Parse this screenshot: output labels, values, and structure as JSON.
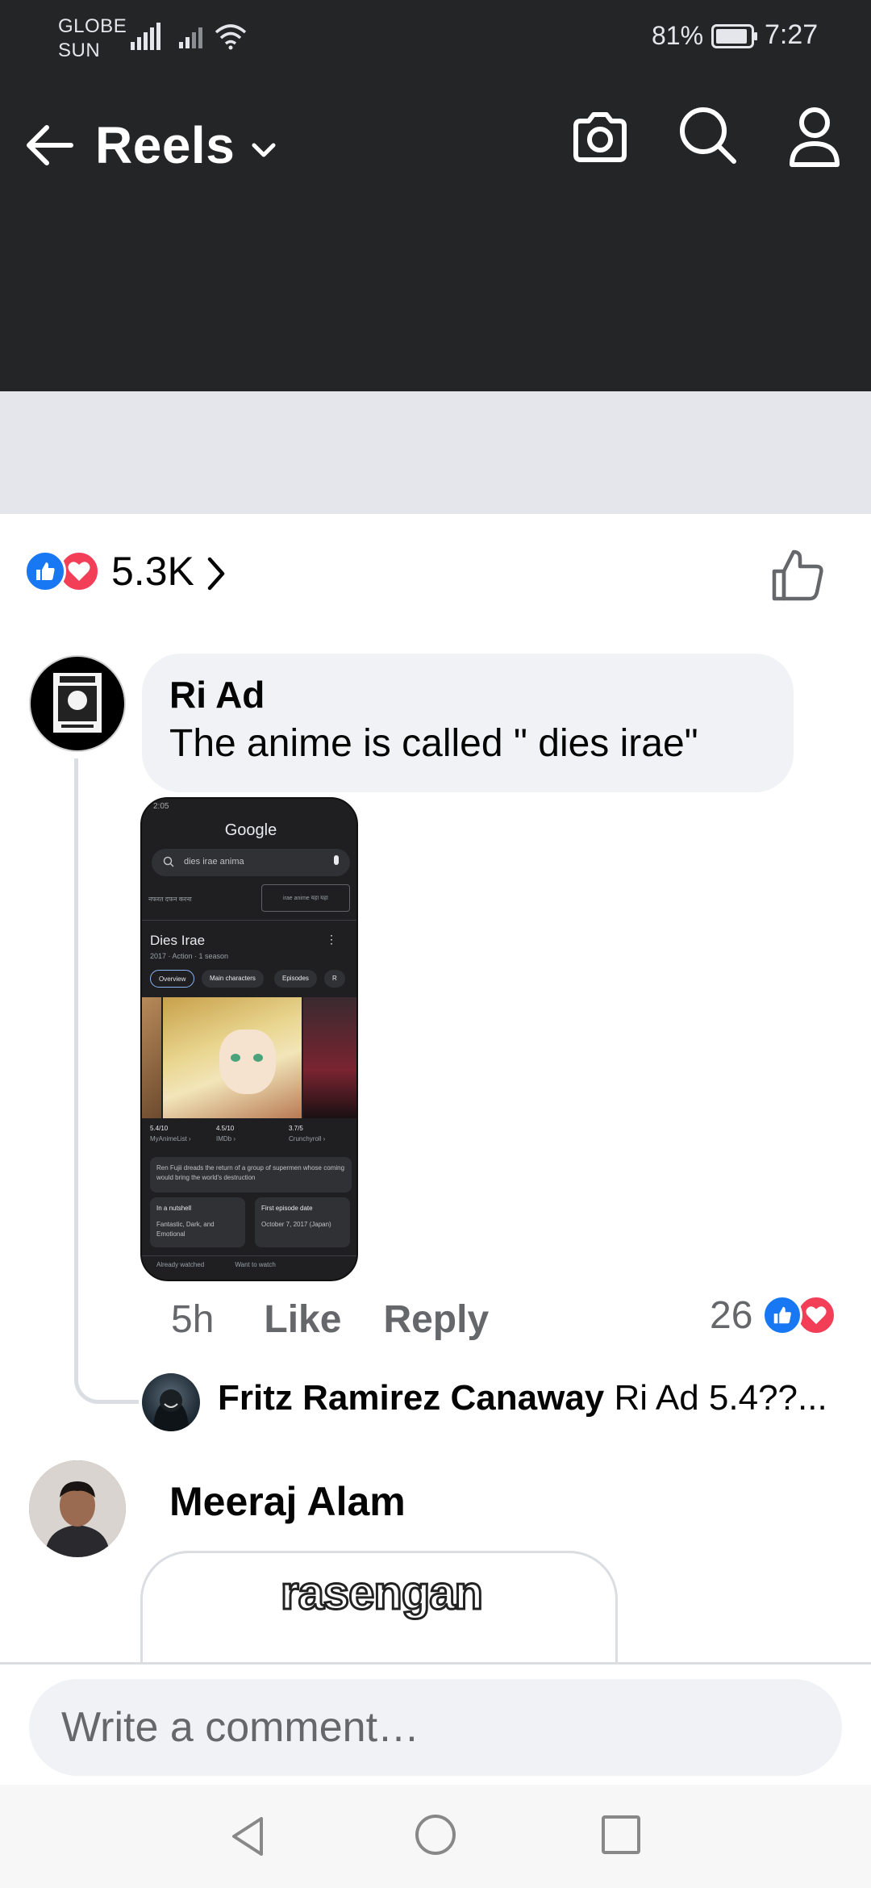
{
  "status_bar": {
    "carrier_line1": "GLOBE",
    "carrier_line2": "SUN",
    "battery": "81%",
    "time": "7:27"
  },
  "header": {
    "title": "Reels",
    "icons": [
      "back-arrow-icon",
      "chevron-down-icon",
      "camera-icon",
      "search-icon",
      "profile-icon"
    ]
  },
  "reactions": {
    "count": "5.3K",
    "types": [
      "like",
      "love"
    ]
  },
  "comments": [
    {
      "author": "Ri Ad",
      "text": "The anime is called \" dies irae\"",
      "time": "5h",
      "like_label": "Like",
      "reply_label": "Reply",
      "reaction_count": "26",
      "attachment": {
        "google": "Google",
        "query": "dies irae anima",
        "lens_query": "irae anime यहा यहा",
        "left_note": "नफरत दफन करना",
        "title": "Dies Irae",
        "subtitle": "2017 · Action · 1 season",
        "chips": [
          "Overview",
          "Main characters",
          "Episodes",
          "R"
        ],
        "ratings": [
          {
            "score": "5.4/10",
            "source": "MyAnimeList ›"
          },
          {
            "score": "4.5/10",
            "source": "IMDb ›"
          },
          {
            "score": "3.7/5",
            "source": "Crunchyroll ›"
          }
        ],
        "description": "Ren Fujii dreads the return of a group of supermen whose coming would bring the world's destruction",
        "card1_title": "In a nutshell",
        "card1_text": "Fantastic, Dark, and Emotional",
        "card2_title": "First episode date",
        "card2_text": "October 7, 2017 (Japan)",
        "bottom_left": "Already watched",
        "bottom_right": "Want to watch",
        "mini_status": "2:05"
      },
      "reply": {
        "author": "Fritz Ramirez Canaway",
        "preview": "Ri Ad 5.4??..."
      }
    },
    {
      "author": "Meeraj Alam",
      "sticker_text": "rasengan"
    }
  ],
  "composer": {
    "placeholder": "Write a comment…"
  },
  "colors": {
    "top_bar": "#242526",
    "accent_like": "#1877f2",
    "accent_love": "#f33e58",
    "bubble": "#f0f2f5",
    "secondary_text": "#65676b"
  }
}
